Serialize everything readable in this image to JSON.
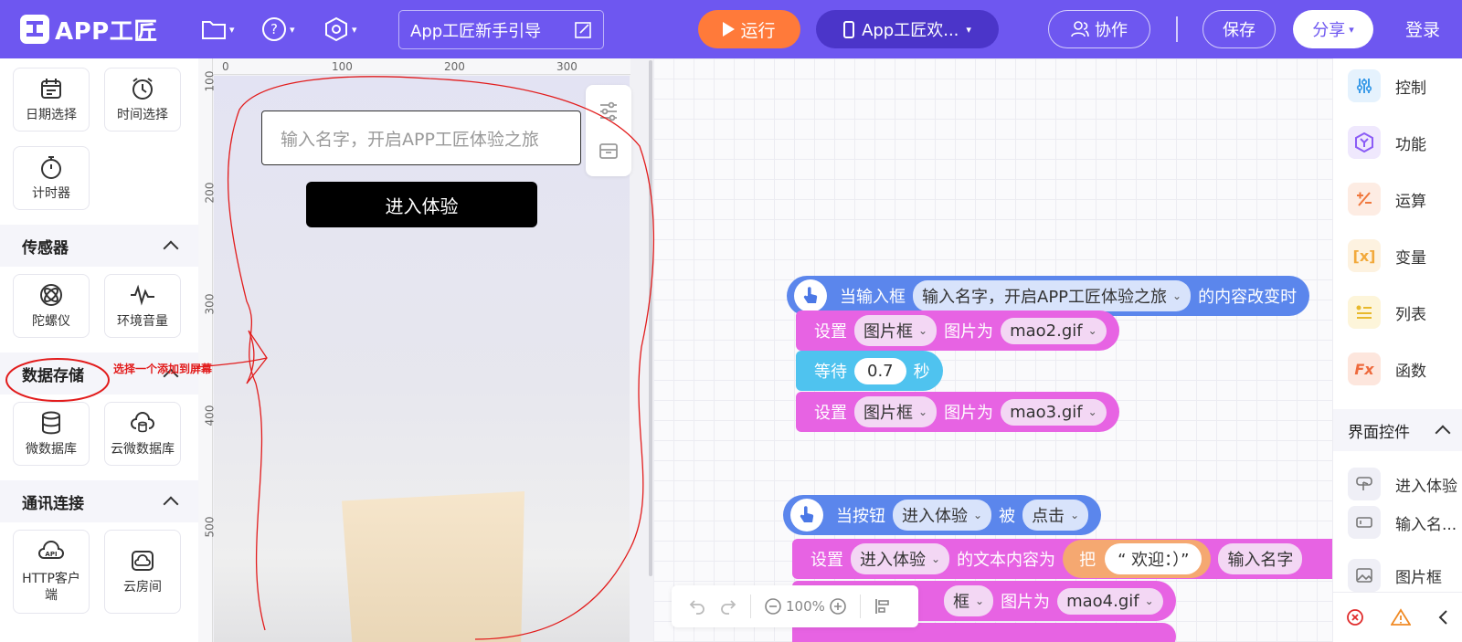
{
  "topbar": {
    "logo_text": "APP工匠",
    "guide_label": "App工匠新手引导",
    "run_label": "运行",
    "device_label": "App工匠欢...",
    "collab_label": "协作",
    "save_label": "保存",
    "share_label": "分享",
    "login_label": "登录"
  },
  "left_panel": {
    "top_items": [
      {
        "label": "日期选择",
        "icon": "calendar-icon"
      },
      {
        "label": "时间选择",
        "icon": "alarm-clock-icon"
      },
      {
        "label": "计时器",
        "icon": "stopwatch-icon"
      }
    ],
    "sections": [
      {
        "title": "传感器",
        "items": [
          {
            "label": "陀螺仪",
            "icon": "gyroscope-icon"
          },
          {
            "label": "环境音量",
            "icon": "sound-wave-icon"
          }
        ]
      },
      {
        "title": "数据存储",
        "items": [
          {
            "label": "微数据库",
            "icon": "database-icon"
          },
          {
            "label": "云微数据库",
            "icon": "cloud-database-icon"
          }
        ]
      },
      {
        "title": "通讯连接",
        "items": [
          {
            "label": "HTTP客户端",
            "icon": "http-api-icon"
          },
          {
            "label": "云房间",
            "icon": "cloud-room-icon"
          }
        ]
      }
    ]
  },
  "ruler": {
    "h": [
      "0",
      "100",
      "200",
      "300"
    ],
    "v": [
      "100",
      "200",
      "300",
      "400",
      "500"
    ]
  },
  "phone": {
    "input_placeholder": "输入名字，开启APP工匠体验之旅",
    "button_label": "进入体验"
  },
  "blocks": {
    "event1": {
      "prefix": "当输入框",
      "target": "输入名字，开启APP工匠体验之旅",
      "suffix": "的内容改变时"
    },
    "set1": {
      "prefix": "设置",
      "component": "图片框",
      "prop": "图片为",
      "value": "mao2.gif"
    },
    "wait": {
      "prefix": "等待",
      "value": "0.7",
      "unit": "秒"
    },
    "set2": {
      "prefix": "设置",
      "component": "图片框",
      "prop": "图片为",
      "value": "mao3.gif"
    },
    "event2": {
      "prefix": "当按钮",
      "target": "进入体验",
      "mid": "被",
      "action": "点击"
    },
    "set3": {
      "prefix": "设置",
      "component": "进入体验",
      "prop": "的文本内容为",
      "concat_label": "把",
      "str": "“ 欢迎：）”",
      "input_ref": "输入名字"
    },
    "set4": {
      "component": "框",
      "prop": "图片为",
      "value": "mao4.gif"
    }
  },
  "ws_toolbar": {
    "zoom": "100%"
  },
  "right_panel": {
    "categories": [
      {
        "label": "控制",
        "icon": "sliders-icon",
        "color": "#3b9be8"
      },
      {
        "label": "功能",
        "icon": "function-hex-icon",
        "color": "#8b5cf6"
      },
      {
        "label": "运算",
        "icon": "math-ops-icon",
        "color": "#f0773c"
      },
      {
        "label": "变量",
        "icon": "variable-icon",
        "color": "#f2a93b"
      },
      {
        "label": "列表",
        "icon": "list-icon",
        "color": "#e8b92c"
      },
      {
        "label": "函数",
        "icon": "fx-icon",
        "color": "#ee6a3d"
      }
    ],
    "section_title": "界面控件",
    "controls": [
      "进入体验",
      "输入名...",
      "图片框"
    ]
  },
  "annotation": {
    "text": "选择一个添加到屏幕",
    "color": "#e21c1c"
  },
  "colors": {
    "brand": "#6e57f0",
    "run": "#ff7a3a",
    "event_block": "#5b86ec",
    "set_block": "#e763e3",
    "wait_block": "#4fc3ef"
  }
}
